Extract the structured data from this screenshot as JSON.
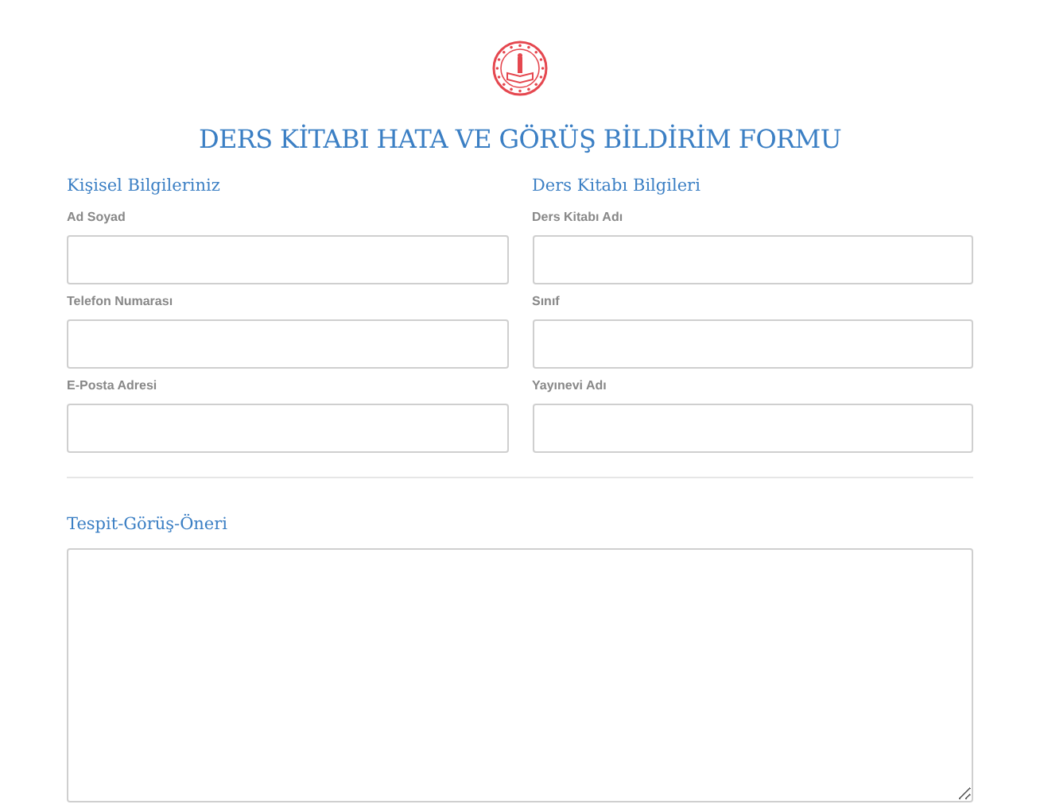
{
  "title": "DERS KİTABI HATA VE GÖRÜŞ BİLDİRİM FORMU",
  "columns": [
    {
      "heading": "Kişisel Bilgileriniz",
      "fields": [
        {
          "label": "Ad Soyad"
        },
        {
          "label": "Telefon Numarası"
        },
        {
          "label": "E-Posta Adresi"
        }
      ]
    },
    {
      "heading": "Ders Kitabı Bilgileri",
      "fields": [
        {
          "label": "Ders Kitabı Adı"
        },
        {
          "label": "Sınıf"
        },
        {
          "label": "Yayınevi Adı"
        }
      ]
    }
  ],
  "comment": {
    "heading": "Tespit-Görüş-Öneri"
  }
}
